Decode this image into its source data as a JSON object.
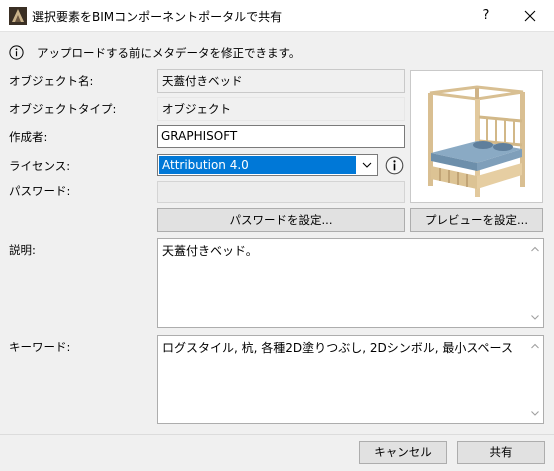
{
  "window": {
    "title": "選択要素をBIMコンポーネントポータルで共有",
    "help_glyph": "?"
  },
  "info": {
    "message": "アップロードする前にメタデータを修正できます。"
  },
  "form": {
    "object_name": {
      "label": "オブジェクト名:",
      "value": "天蓋付きベッド"
    },
    "object_type": {
      "label": "オブジェクトタイプ:",
      "value": "オブジェクト"
    },
    "author": {
      "label": "作成者:",
      "value": "GRAPHISOFT"
    },
    "license": {
      "label": "ライセンス:",
      "value": "Attribution 4.0"
    },
    "password": {
      "label": "パスワード:",
      "value": ""
    },
    "description": {
      "label": "説明:",
      "value": "天蓋付きベッド。"
    },
    "keywords": {
      "label": "キーワード:",
      "value": "ログスタイル, 杭, 各種2D塗りつぶし, 2Dシンボル, 最小スペース"
    }
  },
  "buttons": {
    "set_password": "パスワードを設定...",
    "set_preview": "プレビューを設定...",
    "cancel": "キャンセル",
    "share": "共有"
  },
  "icons": {
    "app": "archicad-app-icon",
    "info": "info-circle-icon",
    "license_info": "info-circle-icon",
    "select_arrow": "chevron-down-icon",
    "close": "close-icon",
    "preview": "canopy-bed-preview-image"
  },
  "colors": {
    "selection": "#0078d7",
    "dialog_background": "#f0f0f0",
    "button_face": "#e1e1e1"
  }
}
